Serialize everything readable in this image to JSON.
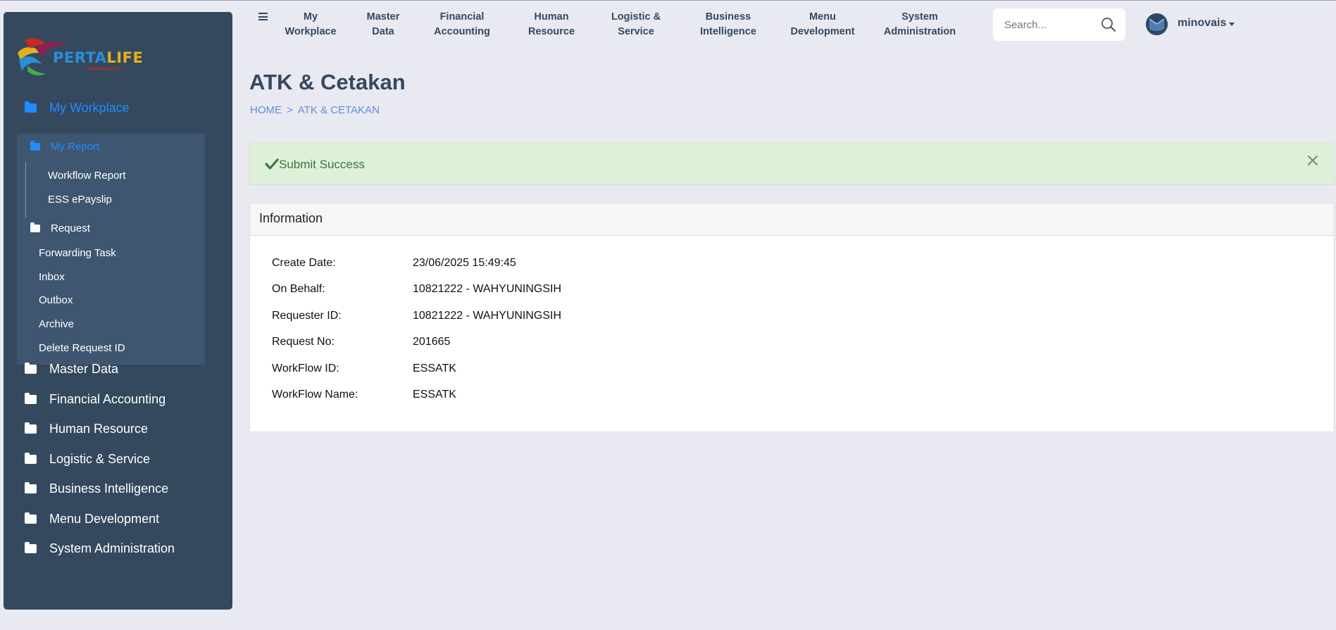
{
  "app": {
    "logo_text_1": "PERTA",
    "logo_text_2": "LIFE",
    "logo_sub": "INSURANCE"
  },
  "sidebar": {
    "items": [
      {
        "label": "My Workplace"
      },
      {
        "label": "Master Data"
      },
      {
        "label": "Financial Accounting"
      },
      {
        "label": "Human Resource"
      },
      {
        "label": "Logistic & Service"
      },
      {
        "label": "Business Intelligence"
      },
      {
        "label": "Menu Development"
      },
      {
        "label": "System Administration"
      }
    ],
    "my_report": {
      "label": "My Report",
      "children": [
        {
          "label": "Workflow Report"
        },
        {
          "label": "ESS ePayslip"
        }
      ]
    },
    "request": {
      "label": "Request",
      "children": [
        {
          "label": "Forwarding Task"
        },
        {
          "label": "Inbox"
        },
        {
          "label": "Outbox"
        },
        {
          "label": "Archive"
        },
        {
          "label": "Delete Request ID"
        }
      ]
    }
  },
  "topnav": {
    "items": [
      {
        "label": "My\nWorkplace"
      },
      {
        "label": "Master\nData"
      },
      {
        "label": "Financial\nAccounting"
      },
      {
        "label": "Human\nResource"
      },
      {
        "label": "Logistic &\nService"
      },
      {
        "label": "Business\nIntelligence"
      },
      {
        "label": "Menu\nDevelopment"
      },
      {
        "label": "System\nAdministration"
      }
    ],
    "search_placeholder": "Search...",
    "username": "minovais"
  },
  "page": {
    "title": "ATK & Cetakan",
    "breadcrumb": [
      "HOME",
      ">",
      "ATK & CETAKAN"
    ]
  },
  "alert": {
    "message": "Submit Success",
    "close": "×"
  },
  "info": {
    "heading": "Information",
    "rows": [
      {
        "label": "Create Date:",
        "value": "23/06/2025 15:49:45"
      },
      {
        "label": "On Behalf:",
        "value": "10821222 - WAHYUNINGSIH"
      },
      {
        "label": "Requester ID:",
        "value": "10821222 - WAHYUNINGSIH"
      },
      {
        "label": "Request No:",
        "value": "201665"
      },
      {
        "label": "WorkFlow ID:",
        "value": "ESSATK"
      },
      {
        "label": "WorkFlow Name:",
        "value": "ESSATK"
      }
    ]
  },
  "colors": {
    "sidebar_bg": "#34495e",
    "submenu_bg": "#3f5670",
    "active_link": "#1e8cff",
    "alert_bg": "#dff0d8",
    "alert_text": "#3c763d",
    "page_bg": "#e9e9f2"
  }
}
